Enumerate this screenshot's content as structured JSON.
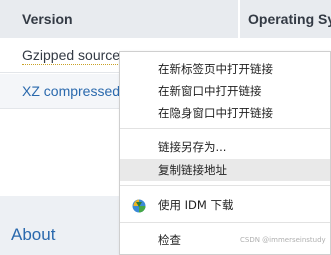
{
  "table": {
    "headers": [
      "Version",
      "Operating Sys"
    ],
    "rows": [
      {
        "link": "Gzipped source"
      },
      {
        "link": "XZ compressed"
      }
    ]
  },
  "footer": {
    "about": "About"
  },
  "context_menu": {
    "items": [
      {
        "label": "在新标签页中打开链接"
      },
      {
        "label": "在新窗口中打开链接"
      },
      {
        "label": "在隐身窗口中打开链接"
      },
      {
        "label": "链接另存为..."
      },
      {
        "label": "复制链接地址"
      },
      {
        "label": "使用 IDM 下载"
      },
      {
        "label": "检查"
      }
    ],
    "highlighted_index": 4
  },
  "watermark": "CSDN @immerseinstudy",
  "colors": {
    "link_blue": "#2a69ad",
    "header_bg": "#e8ebef",
    "highlight_bg": "#e9e9e9"
  }
}
